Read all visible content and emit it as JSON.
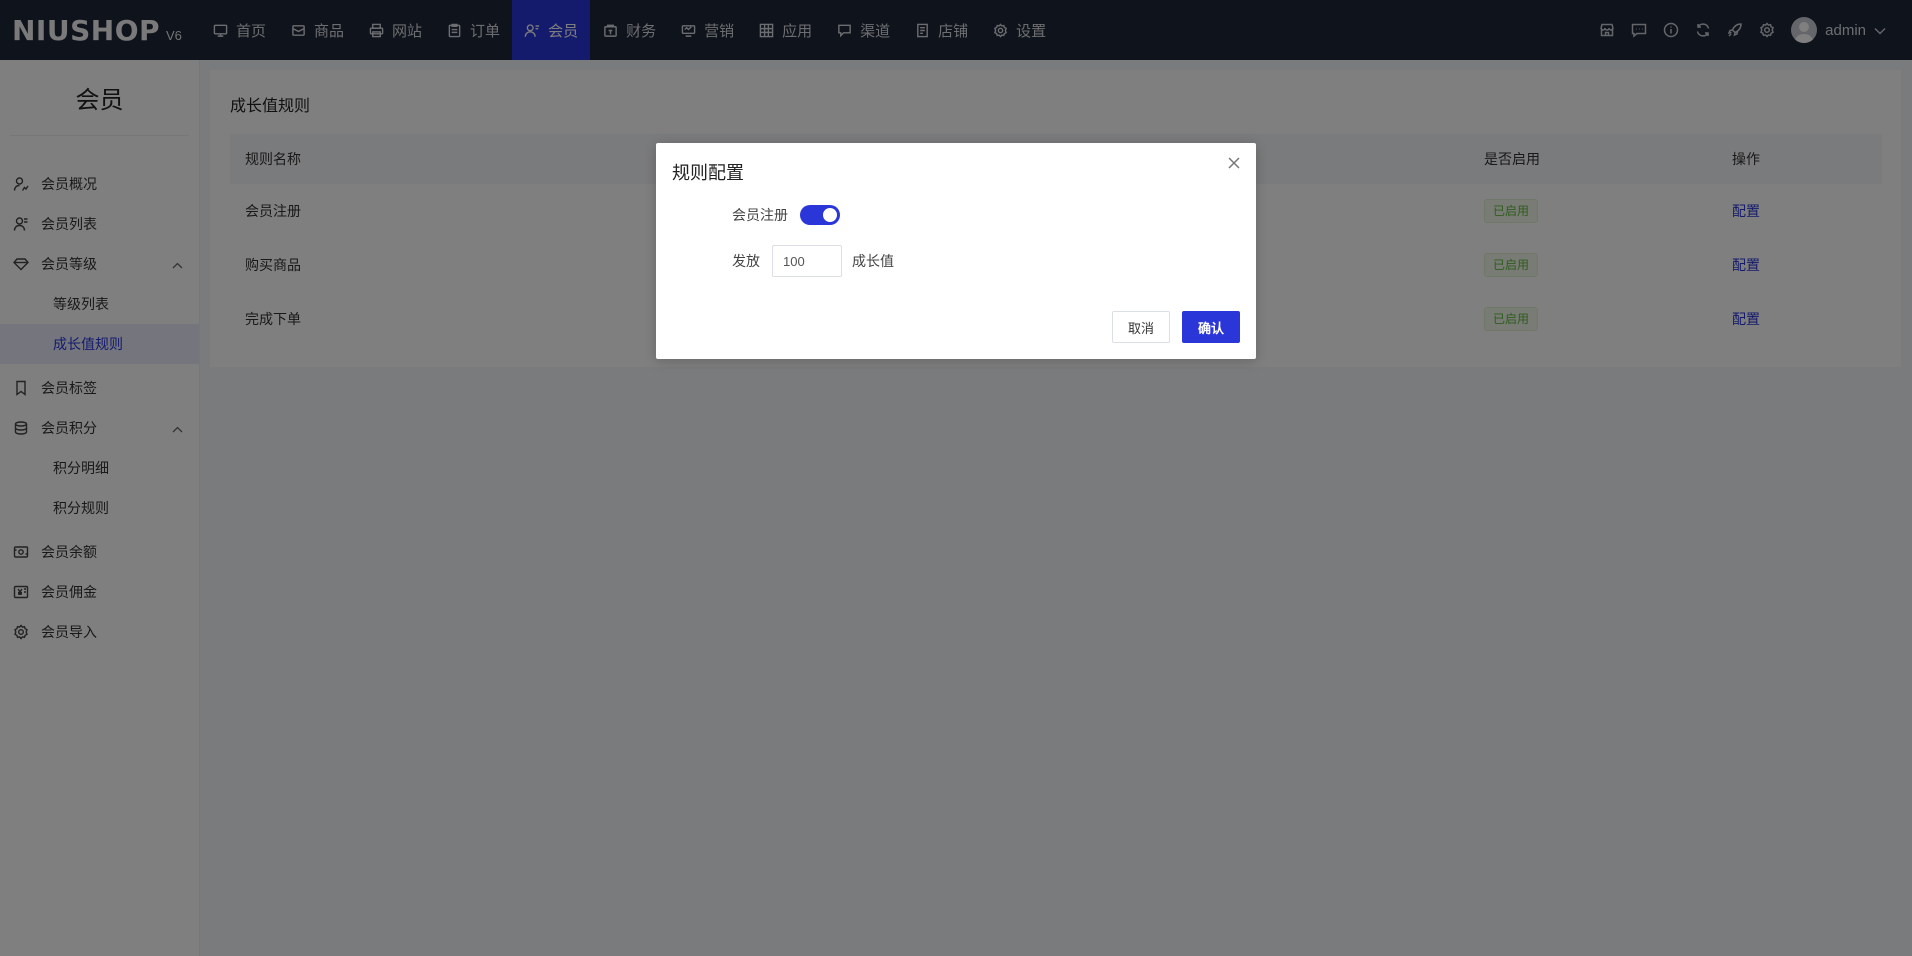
{
  "brand": {
    "logo": "NIUSHOP",
    "version": "V6"
  },
  "nav": {
    "items": [
      {
        "label": "首页",
        "icon": "monitor-icon"
      },
      {
        "label": "商品",
        "icon": "box-icon"
      },
      {
        "label": "网站",
        "icon": "printer-icon"
      },
      {
        "label": "订单",
        "icon": "clipboard-icon"
      },
      {
        "label": "会员",
        "icon": "user-icon",
        "active": true
      },
      {
        "label": "财务",
        "icon": "wallet-icon"
      },
      {
        "label": "营销",
        "icon": "marketing-icon"
      },
      {
        "label": "应用",
        "icon": "grid-icon"
      },
      {
        "label": "渠道",
        "icon": "channel-icon"
      },
      {
        "label": "店铺",
        "icon": "store-icon"
      },
      {
        "label": "设置",
        "icon": "gear-icon"
      }
    ],
    "user": "admin"
  },
  "sidebar": {
    "title": "会员",
    "items": [
      {
        "label": "会员概况"
      },
      {
        "label": "会员列表"
      },
      {
        "label": "会员等级"
      },
      {
        "label": "等级列表"
      },
      {
        "label": "成长值规则"
      },
      {
        "label": "会员标签"
      },
      {
        "label": "会员积分"
      },
      {
        "label": "积分明细"
      },
      {
        "label": "积分规则"
      },
      {
        "label": "会员余额"
      },
      {
        "label": "会员佣金"
      },
      {
        "label": "会员导入"
      }
    ]
  },
  "main": {
    "title": "成长值规则",
    "columns": {
      "name": "规则名称",
      "status": "是否启用",
      "op": "操作"
    },
    "rows": [
      {
        "name": "会员注册",
        "status": "已启用",
        "op": "配置"
      },
      {
        "name": "购买商品",
        "status": "已启用",
        "op": "配置"
      },
      {
        "name": "完成下单",
        "status": "已启用",
        "op": "配置"
      }
    ]
  },
  "dialog": {
    "title": "规则配置",
    "switch_label": "会员注册",
    "switch_on": true,
    "give_label": "发放",
    "amount": "100",
    "unit": "成长值",
    "cancel": "取消",
    "confirm": "确认"
  },
  "colors": {
    "primary": "#2b36d9",
    "topbar": "#1f2637",
    "success": "#5fb83a"
  }
}
